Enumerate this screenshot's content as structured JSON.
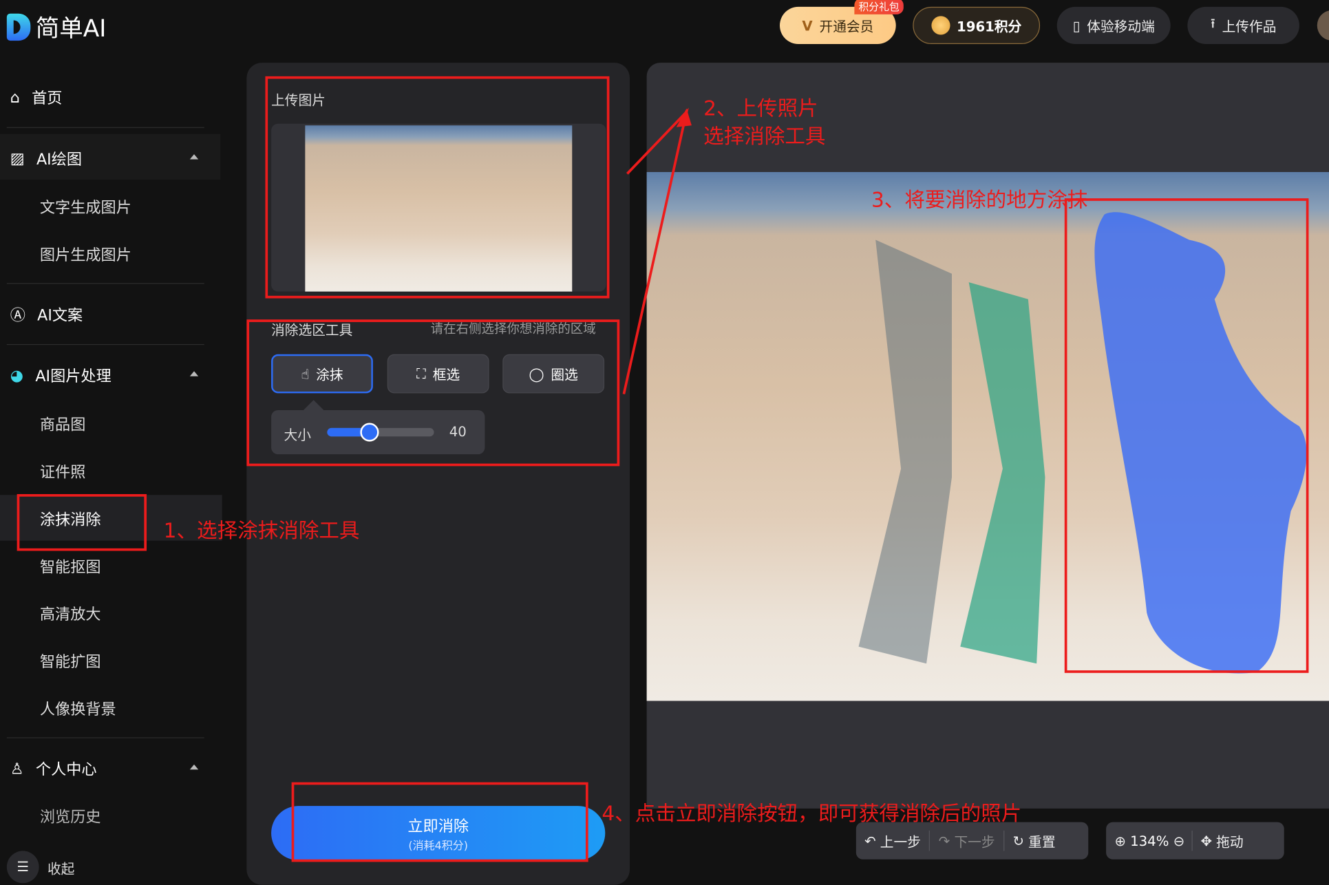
{
  "header": {
    "logo_text": "简单AI",
    "vip_label": "开通会员",
    "vip_badge": "积分礼包",
    "points_label": "1961积分",
    "mobile_label": "体验移动端",
    "upload_label": "上传作品"
  },
  "sidebar": {
    "home": "首页",
    "ai_draw": {
      "label": "AI绘图",
      "items": [
        "文字生成图片",
        "图片生成图片"
      ]
    },
    "ai_copy": "AI文案",
    "ai_image": {
      "label": "AI图片处理",
      "items": [
        "商品图",
        "证件照",
        "涂抹消除",
        "智能抠图",
        "高清放大",
        "智能扩图",
        "人像换背景"
      ],
      "active": "涂抹消除"
    },
    "personal": {
      "label": "个人中心",
      "items": [
        "浏览历史"
      ]
    },
    "collapse": "收起"
  },
  "panel": {
    "upload_title": "上传图片",
    "tool_title": "消除选区工具",
    "tool_hint": "请在右侧选择你想消除的区域",
    "tools": [
      {
        "label": "涂抹",
        "icon": "hand-pointer-icon",
        "active": true
      },
      {
        "label": "框选",
        "icon": "box-select-icon"
      },
      {
        "label": "圈选",
        "icon": "lasso-icon"
      }
    ],
    "size_label": "大小",
    "size_value": "40",
    "size_fraction": 0.4,
    "erase_button": "立即消除",
    "erase_cost": "(消耗4积分)"
  },
  "toolbar": {
    "undo": "上一步",
    "redo": "下一步",
    "reset": "重置",
    "zoom": "134%",
    "drag": "拖动"
  },
  "annotations": {
    "step1": "1、选择涂抹消除工具",
    "step2_line1": "2、上传照片",
    "step2_line2": "选择消除工具",
    "step3": "3、将要消除的地方涂抹",
    "step4": "4、点击立即消除按钮，即可获得消除后的照片"
  },
  "colors": {
    "accent": "#2d6cf5",
    "annotation": "#ec1c1c",
    "mask": "#3a6cf5"
  }
}
